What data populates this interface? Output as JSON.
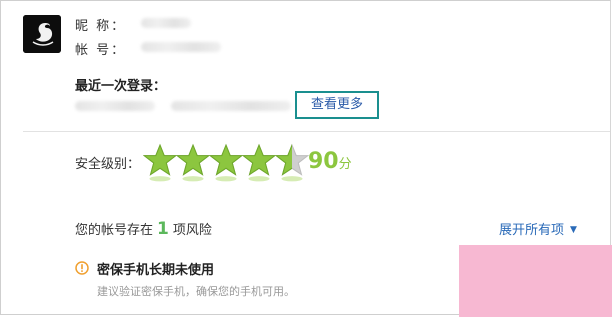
{
  "profile": {
    "avatar": "swan-logo",
    "nickname_label": "昵  称：",
    "account_label": "帐  号："
  },
  "login": {
    "title": "最近一次登录：",
    "more_label": "查看更多"
  },
  "security": {
    "level_label": "安全级别：",
    "stars": 4.5,
    "max_stars": 5,
    "score": "90",
    "score_unit": "分",
    "star_color": "#8cc63f"
  },
  "risk": {
    "prefix": "您的帐号存在",
    "count": "1",
    "suffix": "项风险",
    "expand_label": "展开所有项",
    "item_title": "密保手机长期未使用",
    "item_desc": "建议验证密保手机，确保您的手机可用。",
    "warn_color": "#f0a030"
  }
}
